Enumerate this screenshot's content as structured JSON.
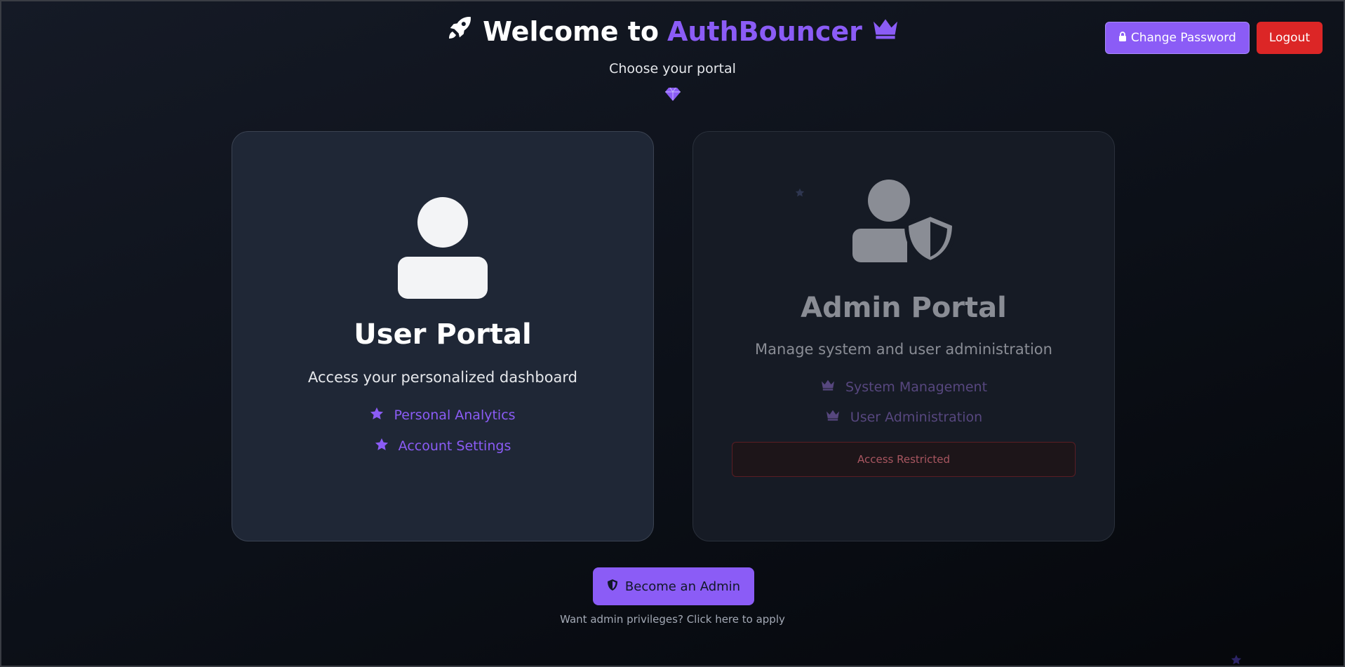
{
  "header": {
    "title_prefix": "Welcome to",
    "title_brand": "AuthBouncer",
    "subtitle": "Choose your portal",
    "icons": [
      "rocket-icon",
      "crown-icon",
      "gem-icon"
    ]
  },
  "top_actions": {
    "change_password_label": "Change Password",
    "logout_label": "Logout"
  },
  "user_portal": {
    "title": "User Portal",
    "description": "Access your personalized dashboard",
    "features": [
      "Personal Analytics",
      "Account Settings"
    ],
    "icon": "user-icon"
  },
  "admin_portal": {
    "title": "Admin Portal",
    "description": "Manage system and user administration",
    "features": [
      "System Management",
      "User Administration"
    ],
    "status": "Access Restricted",
    "icon": "user-shield-icon"
  },
  "become_admin": {
    "label": "Become an Admin",
    "hint": "Want admin privileges? Click here to apply"
  },
  "colors": {
    "accent": "#8b5cf6",
    "danger": "#dc2626",
    "background": "#0c1018"
  }
}
